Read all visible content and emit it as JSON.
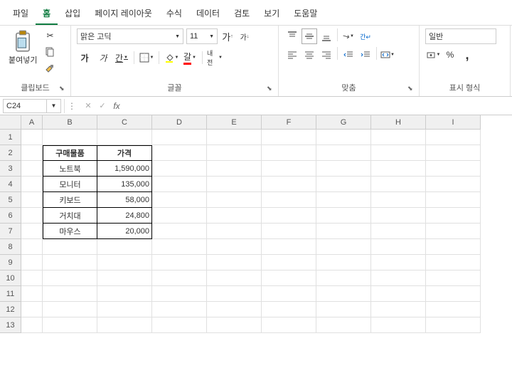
{
  "menu": {
    "items": [
      "파일",
      "홈",
      "삽입",
      "페이지 레이아웃",
      "수식",
      "데이터",
      "검토",
      "보기",
      "도움말"
    ],
    "active_index": 1
  },
  "ribbon": {
    "clipboard": {
      "paste_label": "붙여넣기",
      "group_label": "클립보드"
    },
    "font": {
      "family": "맑은 고딕",
      "size": "11",
      "increase": "가",
      "decrease": "가",
      "bold": "가",
      "italic": "가",
      "underline": "간",
      "font_color": "갈",
      "phonetic": "내전",
      "group_label": "글꼴"
    },
    "alignment": {
      "group_label": "맞춤"
    },
    "number": {
      "format": "일반",
      "percent": "%",
      "comma": ",",
      "group_label": "표시 형식"
    }
  },
  "namebox": "C24",
  "grid": {
    "cols": [
      "A",
      "B",
      "C",
      "D",
      "E",
      "F",
      "G",
      "H",
      "I"
    ],
    "rows": [
      "1",
      "2",
      "3",
      "4",
      "5",
      "6",
      "7",
      "8",
      "9",
      "10",
      "11",
      "12",
      "13"
    ],
    "table": {
      "headers": [
        "구매물품",
        "가격"
      ],
      "rows": [
        [
          "노트북",
          "1,590,000"
        ],
        [
          "모니터",
          "135,000"
        ],
        [
          "키보드",
          "58,000"
        ],
        [
          "거치대",
          "24,800"
        ],
        [
          "마우스",
          "20,000"
        ]
      ]
    }
  }
}
